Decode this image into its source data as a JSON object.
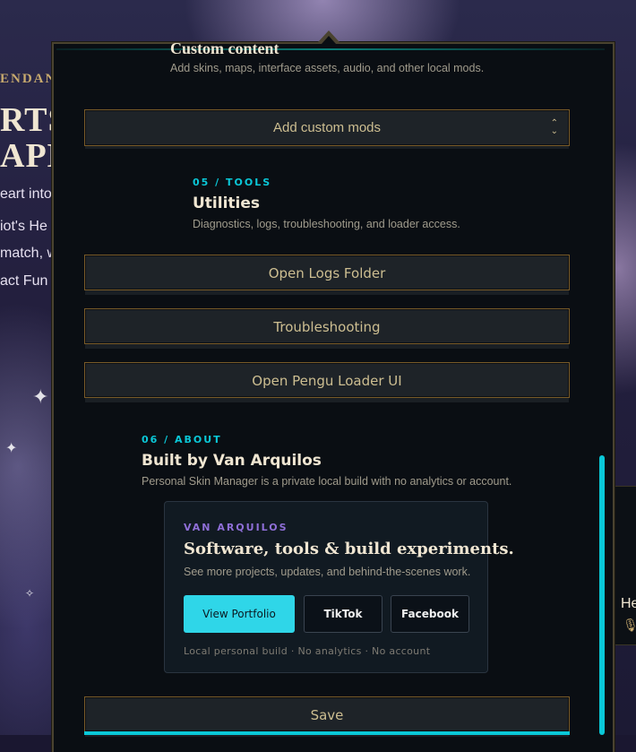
{
  "background": {
    "eyebrow": "ENDAN",
    "headline_1": "RTS",
    "headline_2": "APH",
    "lines": [
      "eart into",
      "iot's He",
      "match, w",
      "act Fun"
    ],
    "right_card_text": "He"
  },
  "custom_content": {
    "title": "Custom content",
    "description": "Add skins, maps, interface assets, audio, and other local mods.",
    "select_label": "Add custom mods"
  },
  "tools": {
    "eyebrow": "05 / TOOLS",
    "title": "Utilities",
    "description": "Diagnostics, logs, troubleshooting, and loader access.",
    "buttons": [
      "Open Logs Folder",
      "Troubleshooting",
      "Open Pengu Loader UI"
    ]
  },
  "about": {
    "eyebrow": "06 / ABOUT",
    "title": "Built by Van Arquilos",
    "description": "Personal Skin Manager is a private local build with no analytics or account.",
    "card": {
      "eyebrow": "VAN ARQUILOS",
      "title": "Software, tools & build experiments.",
      "subtitle": "See more projects, updates, and behind-the-scenes work.",
      "primary_button": "View Portfolio",
      "tiktok_button": "TikTok",
      "facebook_button": "Facebook",
      "footer": "Local personal build · No analytics · No account"
    }
  },
  "save_label": "Save",
  "colors": {
    "accent_cyan": "#0ac8d8",
    "gold_border": "#785a28",
    "gold_text": "#cdbe91",
    "purple_eyebrow": "#8f6fd8"
  }
}
